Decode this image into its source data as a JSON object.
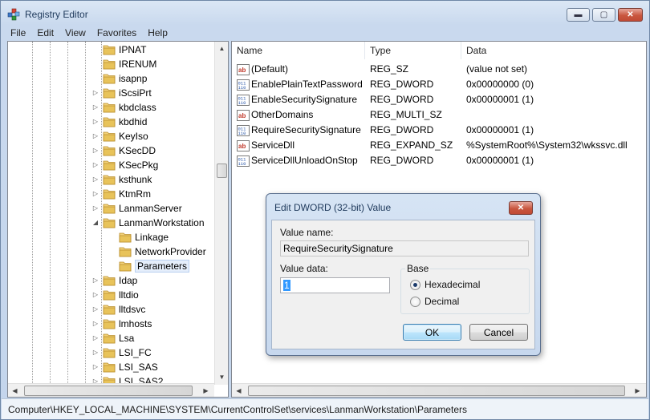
{
  "window": {
    "title": "Registry Editor",
    "min_glyph": "▬",
    "max_glyph": "▢",
    "close_glyph": "✕"
  },
  "menu": [
    "File",
    "Edit",
    "View",
    "Favorites",
    "Help"
  ],
  "tree": {
    "items": [
      {
        "label": "IPNAT",
        "expander": ""
      },
      {
        "label": "IRENUM",
        "expander": ""
      },
      {
        "label": "isapnp",
        "expander": ""
      },
      {
        "label": "iScsiPrt",
        "expander": "▷"
      },
      {
        "label": "kbdclass",
        "expander": "▷"
      },
      {
        "label": "kbdhid",
        "expander": "▷"
      },
      {
        "label": "KeyIso",
        "expander": "▷"
      },
      {
        "label": "KSecDD",
        "expander": "▷"
      },
      {
        "label": "KSecPkg",
        "expander": "▷"
      },
      {
        "label": "ksthunk",
        "expander": "▷"
      },
      {
        "label": "KtmRm",
        "expander": "▷"
      },
      {
        "label": "LanmanServer",
        "expander": "▷"
      },
      {
        "label": "LanmanWorkstation",
        "expander": "◢"
      },
      {
        "label": "Linkage",
        "expander": "",
        "child": true
      },
      {
        "label": "NetworkProvider",
        "expander": "",
        "child": true
      },
      {
        "label": "Parameters",
        "expander": "",
        "child": true,
        "selected": true
      },
      {
        "label": "Idap",
        "expander": "▷"
      },
      {
        "label": "lltdio",
        "expander": "▷"
      },
      {
        "label": "lltdsvc",
        "expander": "▷"
      },
      {
        "label": "lmhosts",
        "expander": "▷"
      },
      {
        "label": "Lsa",
        "expander": "▷"
      },
      {
        "label": "LSI_FC",
        "expander": "▷"
      },
      {
        "label": "LSI_SAS",
        "expander": "▷"
      },
      {
        "label": "LSI_SAS2",
        "expander": "▷"
      }
    ]
  },
  "list": {
    "columns": [
      "Name",
      "Type",
      "Data"
    ],
    "rows": [
      {
        "icon": "string-value-icon",
        "name": "(Default)",
        "type": "REG_SZ",
        "data": "(value not set)"
      },
      {
        "icon": "binary-value-icon",
        "name": "EnablePlainTextPassword",
        "type": "REG_DWORD",
        "data": "0x00000000 (0)"
      },
      {
        "icon": "binary-value-icon",
        "name": "EnableSecuritySignature",
        "type": "REG_DWORD",
        "data": "0x00000001 (1)"
      },
      {
        "icon": "string-value-icon",
        "name": "OtherDomains",
        "type": "REG_MULTI_SZ",
        "data": ""
      },
      {
        "icon": "binary-value-icon",
        "name": "RequireSecuritySignature",
        "type": "REG_DWORD",
        "data": "0x00000001 (1)"
      },
      {
        "icon": "string-value-icon",
        "name": "ServiceDll",
        "type": "REG_EXPAND_SZ",
        "data": "%SystemRoot%\\System32\\wkssvc.dll"
      },
      {
        "icon": "binary-value-icon",
        "name": "ServiceDllUnloadOnStop",
        "type": "REG_DWORD",
        "data": "0x00000001 (1)"
      }
    ]
  },
  "dialog": {
    "title": "Edit DWORD (32-bit) Value",
    "close_glyph": "✕",
    "value_name_label": "Value name:",
    "value_name": "RequireSecuritySignature",
    "value_data_label": "Value data:",
    "value_data": "1",
    "base_label": "Base",
    "radio_hex": "Hexadecimal",
    "radio_dec": "Decimal",
    "selected_base": "Hexadecimal",
    "ok": "OK",
    "cancel": "Cancel"
  },
  "status": "Computer\\HKEY_LOCAL_MACHINE\\SYSTEM\\CurrentControlSet\\services\\LanmanWorkstation\\Parameters",
  "colors": {
    "selection": "#e5eefb",
    "folder": "#e8c35a",
    "accent": "#3c7fb1"
  }
}
